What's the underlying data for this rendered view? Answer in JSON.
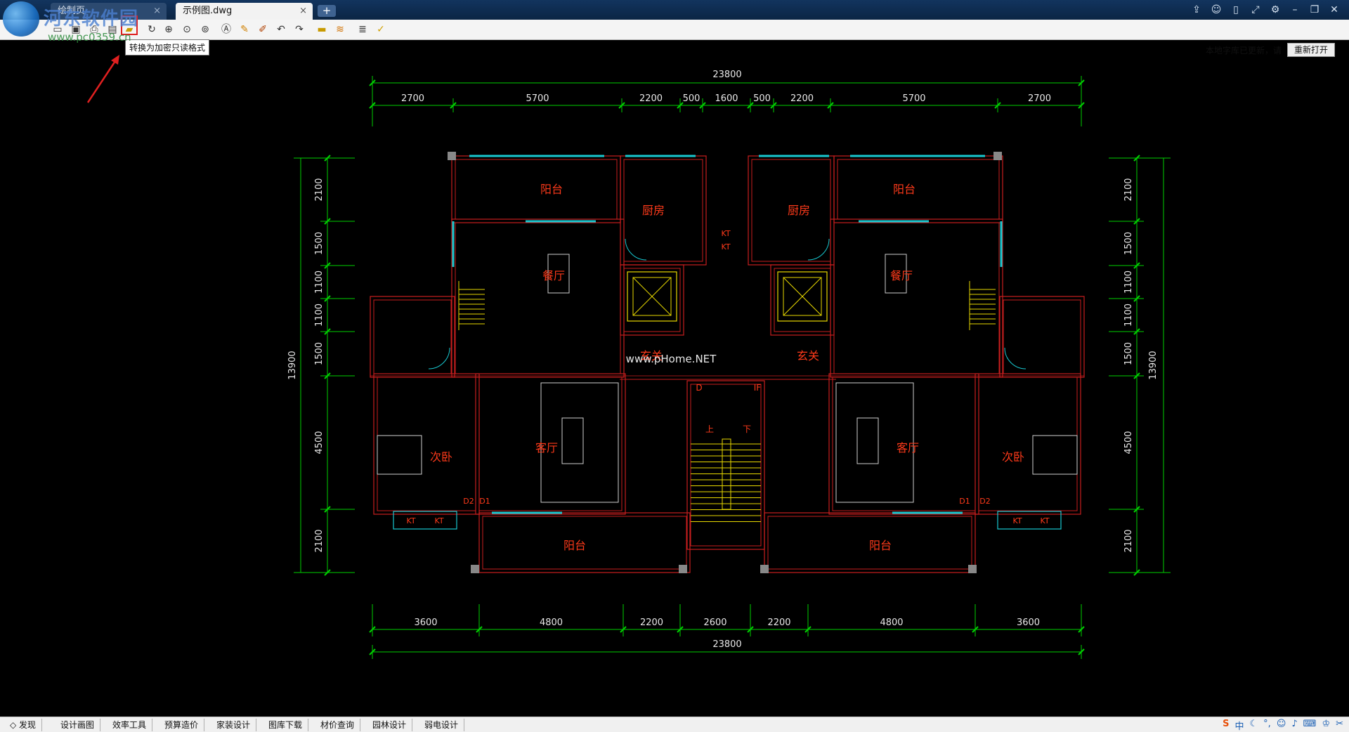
{
  "tabs": [
    {
      "label": "绘制页",
      "active": false
    },
    {
      "label": "示例图.dwg",
      "active": true
    }
  ],
  "tab_close_glyph": "×",
  "tab_add_glyph": "+",
  "watermark": {
    "text": "河东软件园",
    "url": "www.pc0359.cn"
  },
  "window_controls": [
    "share-icon",
    "chat-icon",
    "phone-icon",
    "fullscreen-icon",
    "gear-icon",
    "minimize-icon",
    "restore-icon",
    "close-icon"
  ],
  "toolbar": {
    "icons": [
      "open-folder-icon",
      "save-icon",
      "print-icon",
      "pdf-icon",
      "encrypt-readonly-icon",
      "rotate-icon",
      "zoom-icon",
      "zoom-window-icon",
      "zoom-extents-icon",
      "text-icon",
      "pencil-icon",
      "marker-icon",
      "undo-icon",
      "redo-icon",
      "measure-icon",
      "hatch-icon",
      "layers-icon",
      "check-icon"
    ],
    "tooltip": "转换为加密只读格式",
    "status_text": "本地字库已更新，请",
    "reopen_label": "重新打开"
  },
  "drawing": {
    "top_total": "23800",
    "top_dims": [
      "2700",
      "5700",
      "2200",
      "500",
      "1600",
      "500",
      "2200",
      "5700",
      "2700"
    ],
    "bottom_dims": [
      "3600",
      "4800",
      "2200",
      "2600",
      "2200",
      "4800",
      "3600"
    ],
    "bottom_total": "23800",
    "left_dims": [
      "2100",
      "1500",
      "1100",
      "1100",
      "1500",
      "4500",
      "2100"
    ],
    "left_total": "13900",
    "right_dims": [
      "2100",
      "1500",
      "1100",
      "1100",
      "1500",
      "4500",
      "2100"
    ],
    "right_total": "13900",
    "rooms": {
      "balcony": "阳台",
      "kitchen": "厨房",
      "dining": "餐厅",
      "living": "客厅",
      "bedroom": "次卧",
      "foyer": "玄关"
    },
    "labels": {
      "kt": "KT",
      "d1": "D1",
      "d2": "D2",
      "d": "D",
      "if": "IF",
      "up": "上",
      "down": "下"
    },
    "watermark": "www.pHome.NET"
  },
  "bottombar": {
    "items": [
      "发现",
      "设计画图",
      "效率工具",
      "预算造价",
      "家装设计",
      "图库下载",
      "材价查询",
      "园林设计",
      "弱电设计"
    ]
  },
  "tray": [
    "sogou-icon",
    "中",
    "moon-icon",
    "comma-icon",
    "smile-icon",
    "mic-icon",
    "keyboard-icon",
    "shirt-icon",
    "wrench-icon"
  ]
}
